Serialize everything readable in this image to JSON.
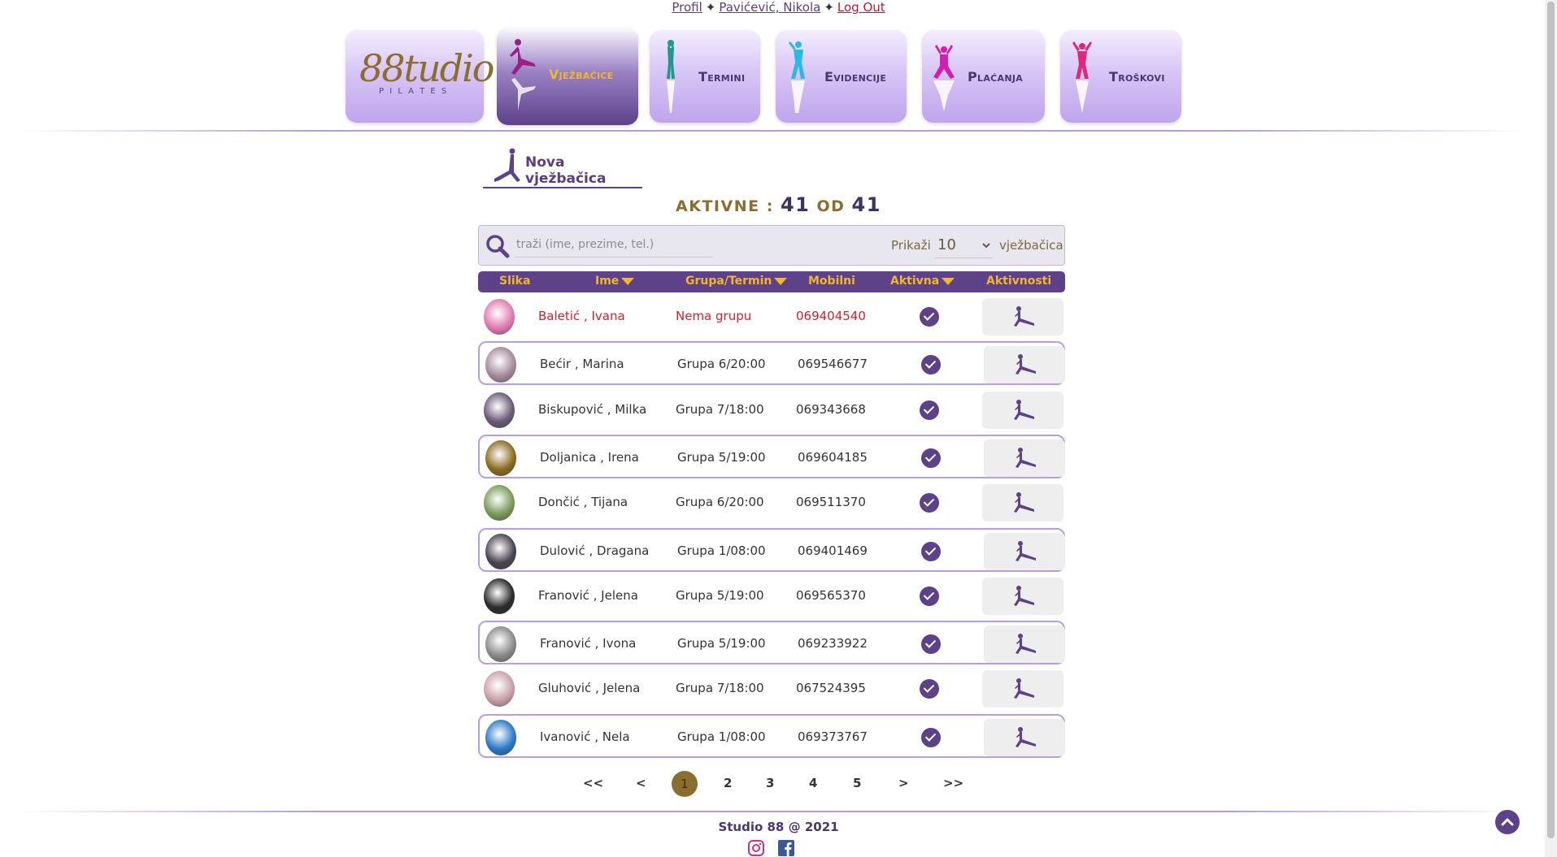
{
  "topbar": {
    "profile": "Profil",
    "user": "Pavićević, Nikola",
    "logout": "Log Out",
    "separator": "✦"
  },
  "nav": {
    "logo_main": "88tudio",
    "logo_sub": "P I L A T E S",
    "tabs": [
      {
        "label": "Vježbačice",
        "icon": "pilates-figure-icon",
        "color": "#9a1f8a"
      },
      {
        "label": "Termini",
        "icon": "standing-figure-icon",
        "color": "#1f9a8a"
      },
      {
        "label": "Evidencije",
        "icon": "figure-icon",
        "color": "#2ab8e4"
      },
      {
        "label": "Plaćanja",
        "icon": "figure-icon",
        "color": "#d21eb4"
      },
      {
        "label": "Troškovi",
        "icon": "figure-icon",
        "color": "#e0287a"
      }
    ]
  },
  "new_member": {
    "label": "Nova vježbačica"
  },
  "counter": {
    "label": "AKTIVNE :",
    "active": "41",
    "of_label": "OD",
    "total": "41"
  },
  "search": {
    "placeholder": "traži (ime, prezime, tel.)",
    "show_label": "Prikaži",
    "page_size": "10",
    "unit_label": "vježbačica"
  },
  "table": {
    "headers": {
      "photo": "Slika",
      "name": "Ime",
      "group": "Grupa/Termin",
      "mobile": "Mobilni",
      "active": "Aktivna",
      "activities": "Aktivnosti"
    },
    "rows": [
      {
        "name": "Baletić , Ivana",
        "group": "Nema grupu",
        "mobile": "069404540",
        "highlight": "red",
        "avatar_color": "#e07ab0"
      },
      {
        "name": "Bećir , Marina",
        "group": "Grupa 6/20:00",
        "mobile": "069546677",
        "avatar_color": "#a58a9c"
      },
      {
        "name": "Biskupović , Milka",
        "group": "Grupa 7/18:00",
        "mobile": "069343668",
        "avatar_color": "#6b5a78"
      },
      {
        "name": "Doljanica , Irena",
        "group": "Grupa 5/19:00",
        "mobile": "069604185",
        "avatar_color": "#8a6a20"
      },
      {
        "name": "Dončić , Tijana",
        "group": "Grupa 6/20:00",
        "mobile": "069511370",
        "avatar_color": "#7a9a5a"
      },
      {
        "name": "Dulović , Dragana",
        "group": "Grupa 1/08:00",
        "mobile": "069401469",
        "avatar_color": "#4a4450"
      },
      {
        "name": "Franović , Jelena",
        "group": "Grupa 5/19:00",
        "mobile": "069565370",
        "avatar_color": "#2a2a2a"
      },
      {
        "name": "Franović , Ivona",
        "group": "Grupa 5/19:00",
        "mobile": "069233922",
        "avatar_color": "#8a8a8a"
      },
      {
        "name": "Gluhović , Jelena",
        "group": "Grupa 7/18:00",
        "mobile": "067524395",
        "avatar_color": "#c9a0a8"
      },
      {
        "name": "Ivanović , Nela",
        "group": "Grupa 1/08:00",
        "mobile": "069373767",
        "avatar_color": "#2a78c8"
      }
    ]
  },
  "pagination": {
    "first": "<<",
    "prev": "<",
    "pages": [
      "1",
      "2",
      "3",
      "4",
      "5"
    ],
    "current": "1",
    "next": ">",
    "last": ">>"
  },
  "footer": {
    "copyright": "Studio 88 @ 2021"
  },
  "colors": {
    "primary": "#5d4189",
    "accent": "#f2b52b",
    "gold": "#8a6d2f",
    "alert": "#d5202f"
  }
}
